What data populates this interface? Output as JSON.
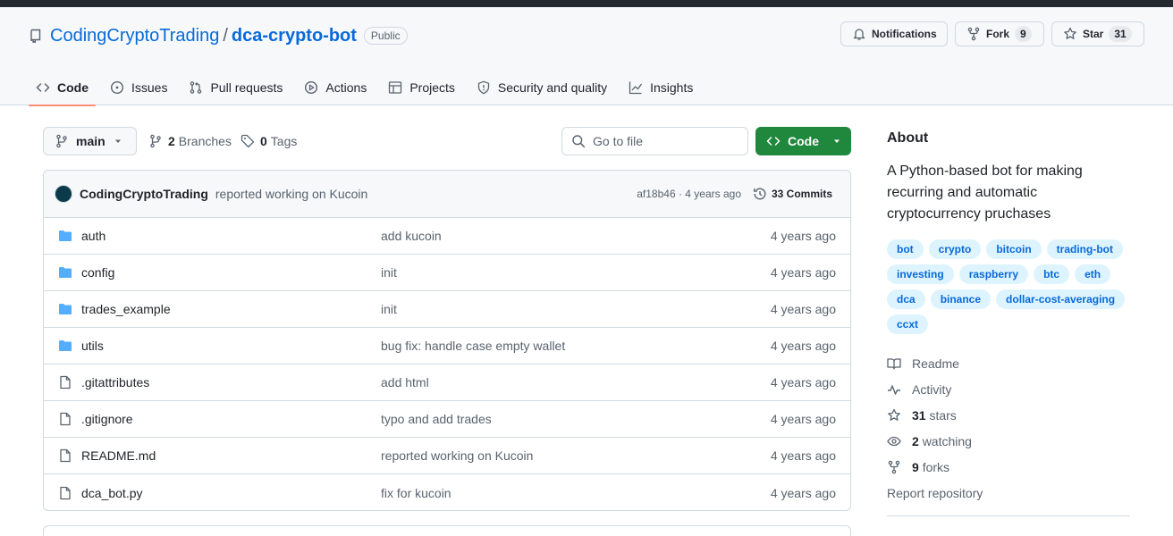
{
  "repo": {
    "owner": "CodingCryptoTrading",
    "separator": "/",
    "name": "dca-crypto-bot",
    "visibility": "Public"
  },
  "header_buttons": {
    "notifications": "Notifications",
    "fork": "Fork",
    "fork_count": "9",
    "star": "Star",
    "star_count": "31"
  },
  "tabs": [
    {
      "label": "Code",
      "icon": "code-icon",
      "active": true
    },
    {
      "label": "Issues",
      "icon": "issue-icon"
    },
    {
      "label": "Pull requests",
      "icon": "pull-request-icon"
    },
    {
      "label": "Actions",
      "icon": "play-icon"
    },
    {
      "label": "Projects",
      "icon": "table-icon"
    },
    {
      "label": "Security and quality",
      "icon": "shield-icon"
    },
    {
      "label": "Insights",
      "icon": "graph-icon"
    }
  ],
  "toolbar": {
    "branch": "main",
    "branches_count": "2",
    "branches_label": "Branches",
    "tags_count": "0",
    "tags_label": "Tags",
    "goto_placeholder": "Go to file",
    "code_button": "Code"
  },
  "latest_commit": {
    "author": "CodingCryptoTrading",
    "message": "reported working on Kucoin",
    "sha_time": "af18b46 · 4 years ago",
    "commits": "33 Commits"
  },
  "files": [
    {
      "name": "auth",
      "type": "folder",
      "message": "add kucoin",
      "date": "4 years ago"
    },
    {
      "name": "config",
      "type": "folder",
      "message": "init",
      "date": "4 years ago"
    },
    {
      "name": "trades_example",
      "type": "folder",
      "message": "init",
      "date": "4 years ago"
    },
    {
      "name": "utils",
      "type": "folder",
      "message": "bug fix: handle case empty wallet",
      "date": "4 years ago"
    },
    {
      "name": ".gitattributes",
      "type": "file",
      "message": "add html",
      "date": "4 years ago"
    },
    {
      "name": ".gitignore",
      "type": "file",
      "message": "typo and add trades",
      "date": "4 years ago"
    },
    {
      "name": "README.md",
      "type": "file",
      "message": "reported working on Kucoin",
      "date": "4 years ago"
    },
    {
      "name": "dca_bot.py",
      "type": "file",
      "message": "fix for kucoin",
      "date": "4 years ago"
    }
  ],
  "about": {
    "heading": "About",
    "description": "A Python-based bot for making recurring and automatic cryptocurrency pruchases",
    "topics": [
      "bot",
      "crypto",
      "bitcoin",
      "trading-bot",
      "investing",
      "raspberry",
      "btc",
      "eth",
      "dca",
      "binance",
      "dollar-cost-averaging",
      "ccxt"
    ],
    "readme": "Readme",
    "activity": "Activity",
    "stars_count": "31",
    "stars_label": "stars",
    "watching_count": "2",
    "watching_label": "watching",
    "forks_count": "9",
    "forks_label": "forks",
    "report": "Report repository"
  },
  "colors": {
    "link": "#0969da",
    "code_button": "#1f883d",
    "active_tab_underline": "#fd8c73",
    "folder_icon": "#54aeff",
    "topic_bg": "#ddf4ff"
  }
}
